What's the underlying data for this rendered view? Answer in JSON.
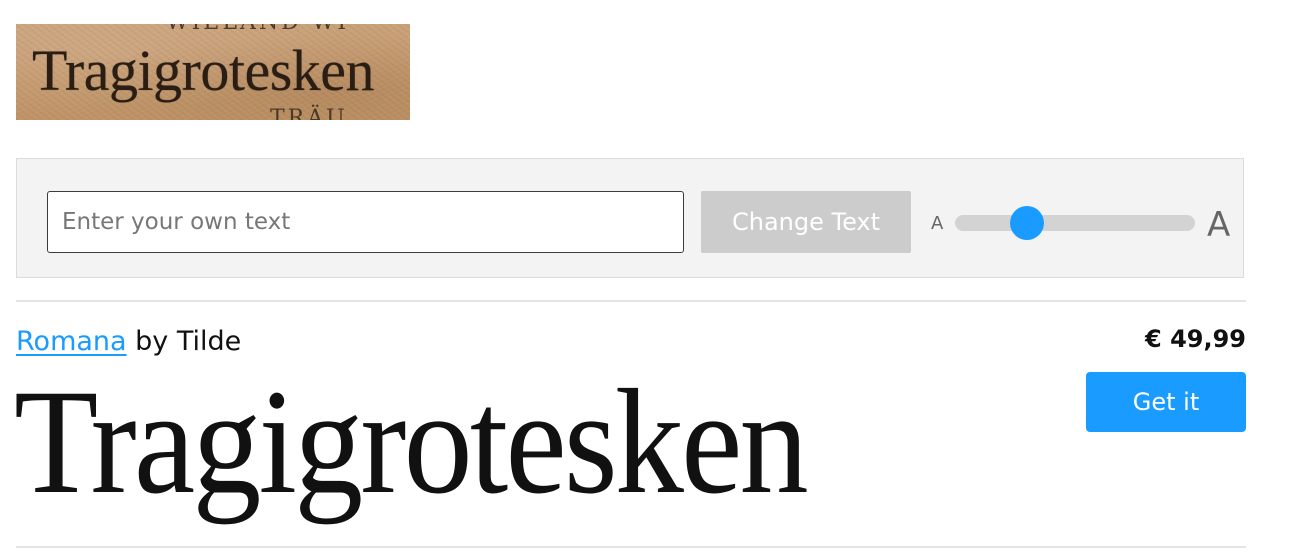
{
  "sample_image": {
    "top_fragment": "WIELAND WI",
    "main_word": "Tragigrotesken",
    "bottom_fragment": "TRÄU"
  },
  "controls": {
    "text_input": {
      "value": "",
      "placeholder": "Enter your own text"
    },
    "change_button_label": "Change Text",
    "size_small_label": "A",
    "size_large_label": "A",
    "size_slider_level": 0.3
  },
  "font": {
    "name": "Romana",
    "by": "by Tilde",
    "price": "€ 49,99",
    "get_button_label": "Get it",
    "preview_text": "Tragigrotesken"
  },
  "colors": {
    "accent": "#1a9bff",
    "disabled_button": "#cccccc"
  }
}
